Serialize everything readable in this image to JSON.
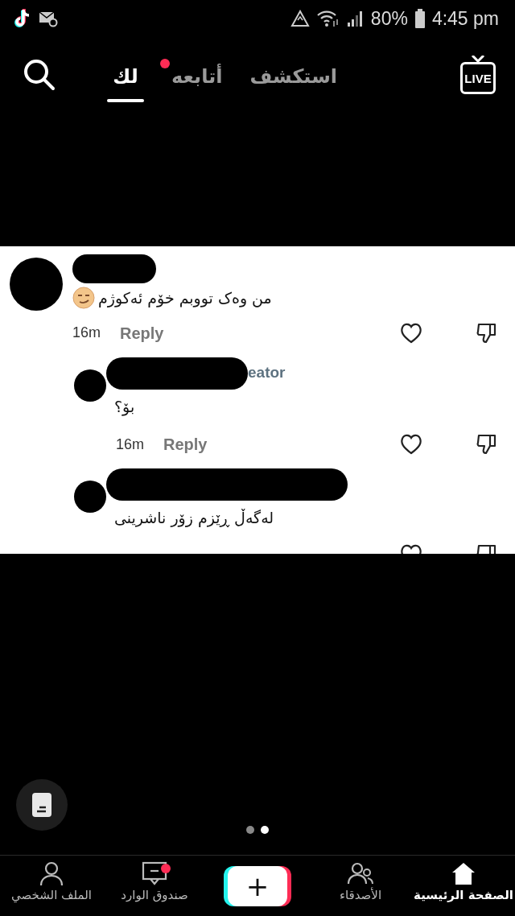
{
  "status_bar": {
    "battery": "80%",
    "time": "4:45 pm"
  },
  "live_button": "LIVE",
  "top_tabs": [
    {
      "label": "استكشف",
      "selected": false,
      "dot": false
    },
    {
      "label": "أتابعه",
      "selected": false,
      "dot": true
    },
    {
      "label": "لك",
      "selected": true,
      "dot": false
    }
  ],
  "post_image": {
    "comments": [
      {
        "kind": "comment",
        "text": "من وەک تووبم خۆم ئەکوژم",
        "emoji": true,
        "time": "16m",
        "reply": "Reply"
      },
      {
        "kind": "reply",
        "author_fragment": "eator",
        "text": "بۆ؟",
        "time": "16m",
        "reply": "Reply"
      },
      {
        "kind": "reply",
        "text": "لەگەڵ ڕێزم زۆر ناشرینی"
      }
    ]
  },
  "page_dots": [
    {
      "selected": false
    },
    {
      "selected": true
    }
  ],
  "bottom_nav": [
    {
      "kind": "tab",
      "label": "الصفحة الرئيسية",
      "selected": true,
      "dot": false
    },
    {
      "kind": "tab",
      "label": "الأصدقاء",
      "selected": false,
      "dot": false
    },
    {
      "kind": "create",
      "label": "+"
    },
    {
      "kind": "tab",
      "label": "صندوق الوارد",
      "selected": false,
      "dot": true
    },
    {
      "kind": "tab",
      "label": "الملف الشخصي",
      "selected": false,
      "dot": false
    }
  ]
}
